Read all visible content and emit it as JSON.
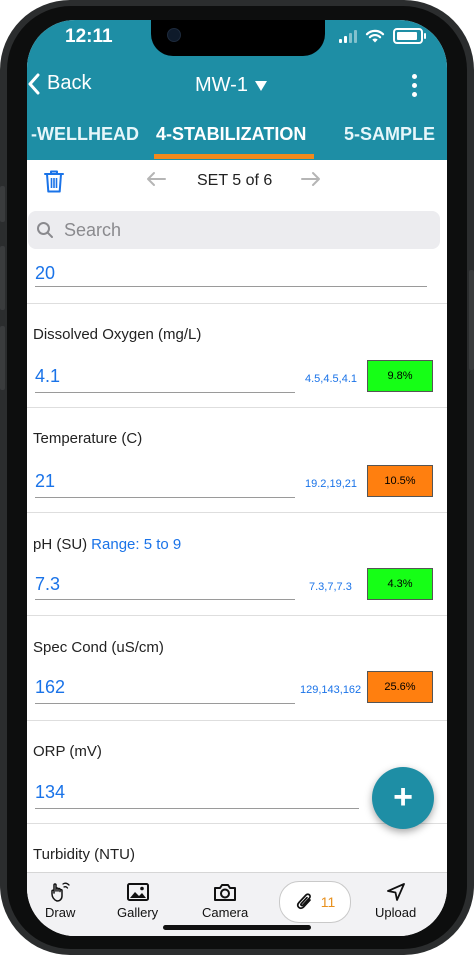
{
  "status_bar": {
    "time": "12:11"
  },
  "nav": {
    "back_label": "Back",
    "title": "MW-1"
  },
  "tabs": [
    {
      "label": "-WELLHEAD"
    },
    {
      "label": "4-STABILIZATION"
    },
    {
      "label": "5-SAMPLE"
    }
  ],
  "set_nav": {
    "label": "SET 5 of 6"
  },
  "search": {
    "placeholder": "Search"
  },
  "fields": [
    {
      "value": "20"
    },
    {
      "label": "Dissolved Oxygen (mg/L)",
      "value": "4.1",
      "history": "4.5,4.5,4.1",
      "change": "9.8%",
      "change_color": "#16ff16"
    },
    {
      "label": "Temperature (C)",
      "value": "21",
      "history": "19.2,19,21",
      "change": "10.5%",
      "change_color": "#ff7f0f"
    },
    {
      "label": "pH (SU)",
      "range": "Range: 5 to 9",
      "value": "7.3",
      "history": "7.3,7,7.3",
      "change": "4.3%",
      "change_color": "#16ff16"
    },
    {
      "label": "Spec Cond (uS/cm)",
      "value": "162",
      "history": "129,143,162",
      "change": "25.6%",
      "change_color": "#ff7f0f"
    },
    {
      "label": "ORP (mV)",
      "value": "134"
    },
    {
      "label": "Turbidity (NTU)"
    }
  ],
  "fab": {
    "icon": "plus-icon"
  },
  "toolbar": {
    "draw_label": "Draw",
    "gallery_label": "Gallery",
    "camera_label": "Camera",
    "attachments_count": "11",
    "upload_label": "Upload"
  },
  "colors": {
    "header": "#1e8ea5",
    "accent": "#f28a1d",
    "link": "#1a73e8"
  }
}
